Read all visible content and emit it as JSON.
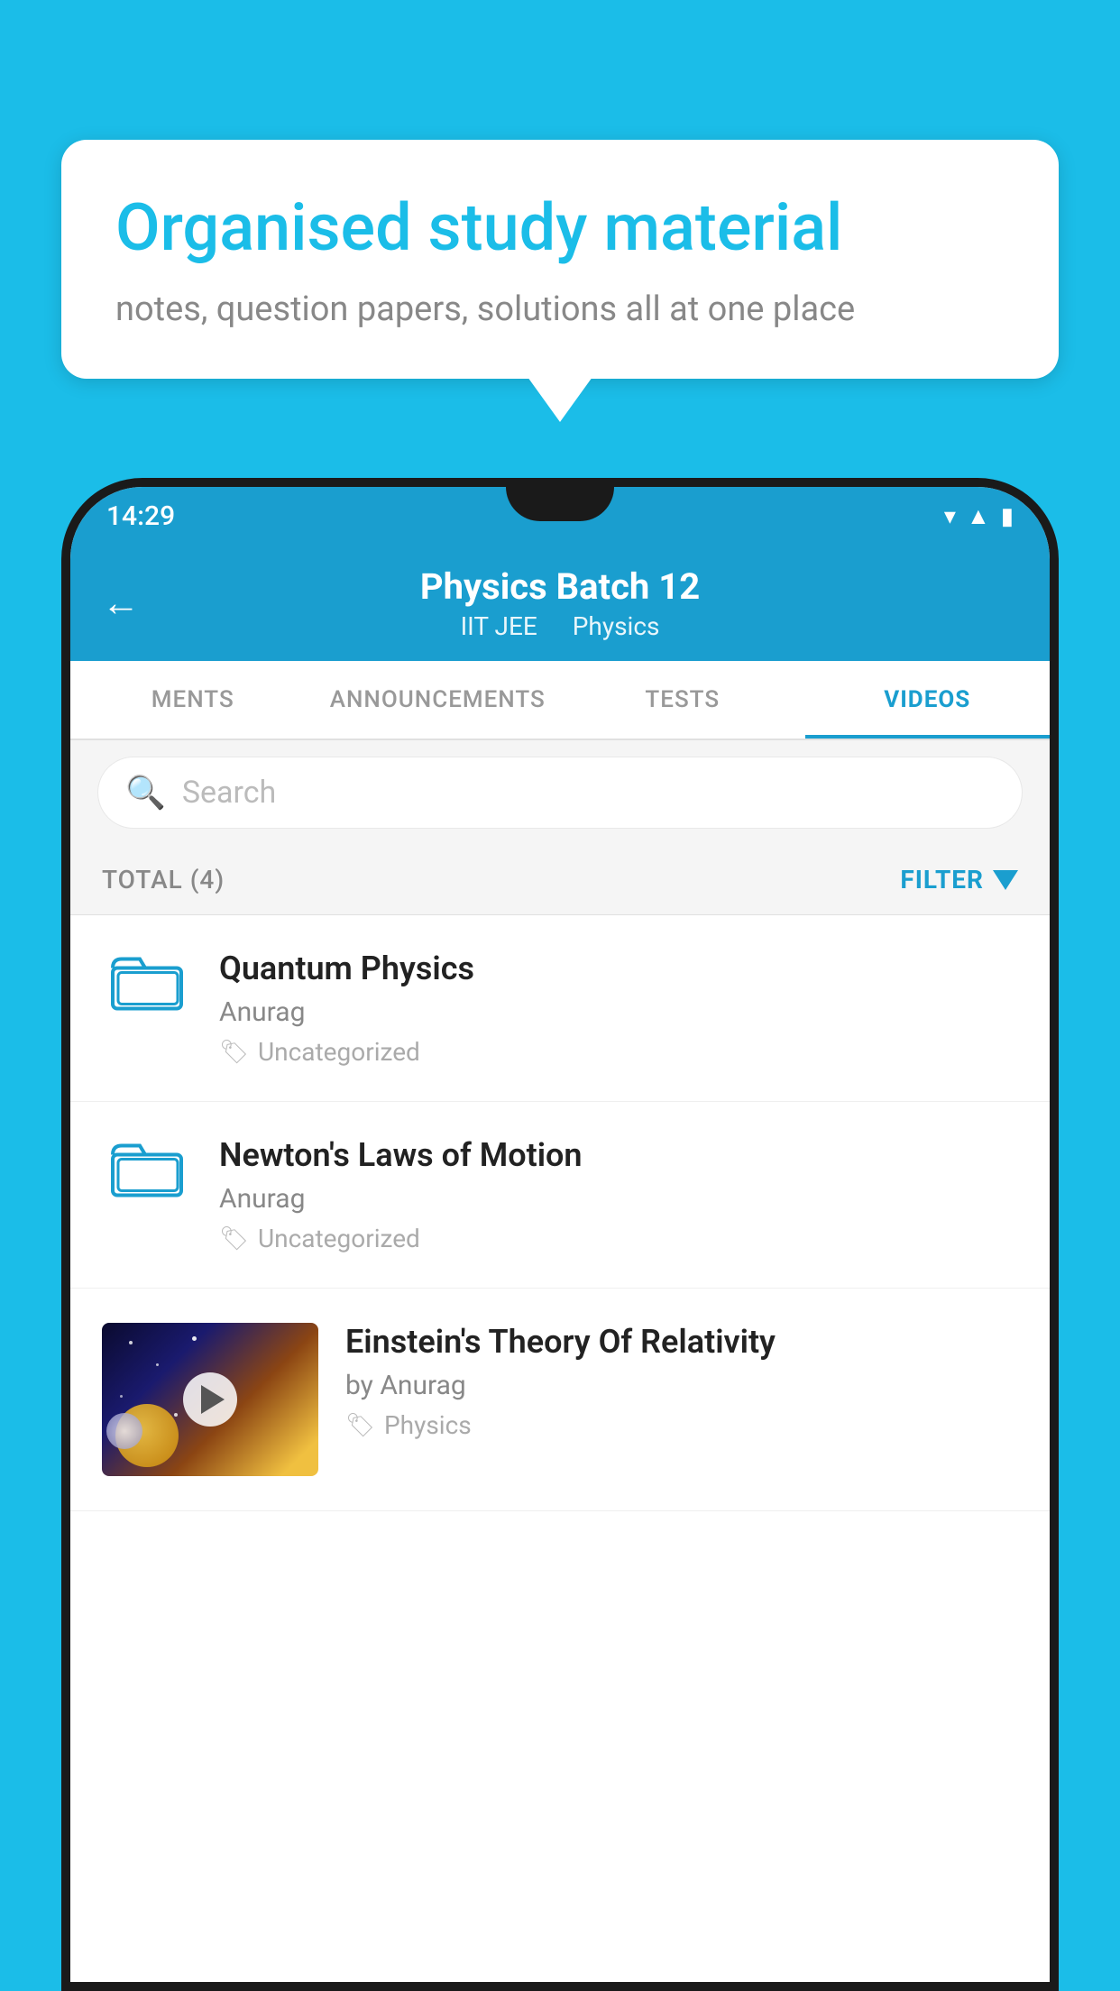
{
  "bubble": {
    "title": "Organised study material",
    "subtitle": "notes, question papers, solutions all at one place"
  },
  "status_bar": {
    "time": "14:29"
  },
  "header": {
    "title": "Physics Batch 12",
    "subtitle1": "IIT JEE",
    "subtitle2": "Physics",
    "back_label": "←"
  },
  "tabs": [
    {
      "label": "MENTS",
      "active": false
    },
    {
      "label": "ANNOUNCEMENTS",
      "active": false
    },
    {
      "label": "TESTS",
      "active": false
    },
    {
      "label": "VIDEOS",
      "active": true
    }
  ],
  "search": {
    "placeholder": "Search"
  },
  "filter": {
    "total_label": "TOTAL (4)",
    "filter_label": "FILTER"
  },
  "videos": [
    {
      "title": "Quantum Physics",
      "author": "Anurag",
      "tag": "Uncategorized",
      "type": "folder"
    },
    {
      "title": "Newton's Laws of Motion",
      "author": "Anurag",
      "tag": "Uncategorized",
      "type": "folder"
    },
    {
      "title": "Einstein's Theory Of Relativity",
      "author": "by Anurag",
      "tag": "Physics",
      "type": "video"
    }
  ]
}
